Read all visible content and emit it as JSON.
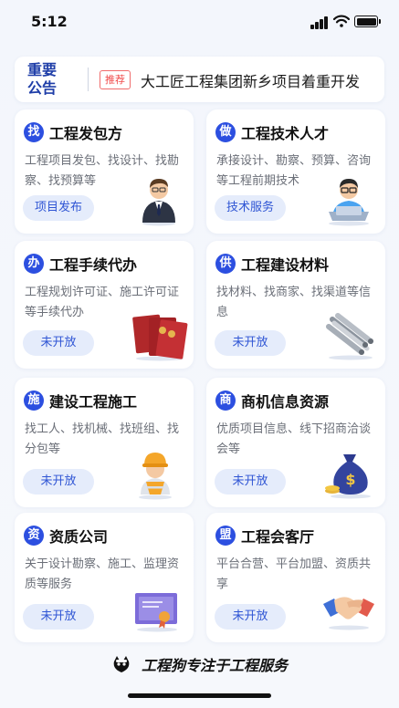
{
  "status_bar": {
    "time": "5:12"
  },
  "notice": {
    "title": "重要公告",
    "tag": "推荐",
    "text": "大工匠工程集团新乡项目着重开发"
  },
  "cards": [
    {
      "badge": "找",
      "title": "工程发包方",
      "desc": "工程项目发包、找设计、找勘察、找预算等",
      "button": "项目发布",
      "illustration": "businessman-icon"
    },
    {
      "badge": "做",
      "title": "工程技术人才",
      "desc": "承接设计、勘察、预算、咨询等工程前期技术",
      "button": "技术服务",
      "illustration": "engineer-laptop-icon"
    },
    {
      "badge": "办",
      "title": "工程手续代办",
      "desc": "工程规划许可证、施工许可证等手续代办",
      "button": "未开放",
      "illustration": "certificates-icon"
    },
    {
      "badge": "供",
      "title": "工程建设材料",
      "desc": "找材料、找商家、找渠道等信息",
      "button": "未开放",
      "illustration": "steel-pipes-icon"
    },
    {
      "badge": "施",
      "title": "建设工程施工",
      "desc": "找工人、找机械、找班组、找分包等",
      "button": "未开放",
      "illustration": "construction-worker-icon"
    },
    {
      "badge": "商",
      "title": "商机信息资源",
      "desc": "优质项目信息、线下招商洽谈会等",
      "button": "未开放",
      "illustration": "money-bag-icon"
    },
    {
      "badge": "资",
      "title": "资质公司",
      "desc": "关于设计勘察、施工、监理资质等服务",
      "button": "未开放",
      "illustration": "certificate-icon"
    },
    {
      "badge": "盟",
      "title": "工程会客厅",
      "desc": "平台合营、平台加盟、资质共享",
      "button": "未开放",
      "illustration": "handshake-icon"
    }
  ],
  "footer": {
    "text": "工程狗专注于工程服务"
  },
  "colors": {
    "accent": "#2c4fe0",
    "button_bg": "#e5ecfb",
    "notice_title": "#1f3ea8",
    "tag": "#f04848"
  }
}
